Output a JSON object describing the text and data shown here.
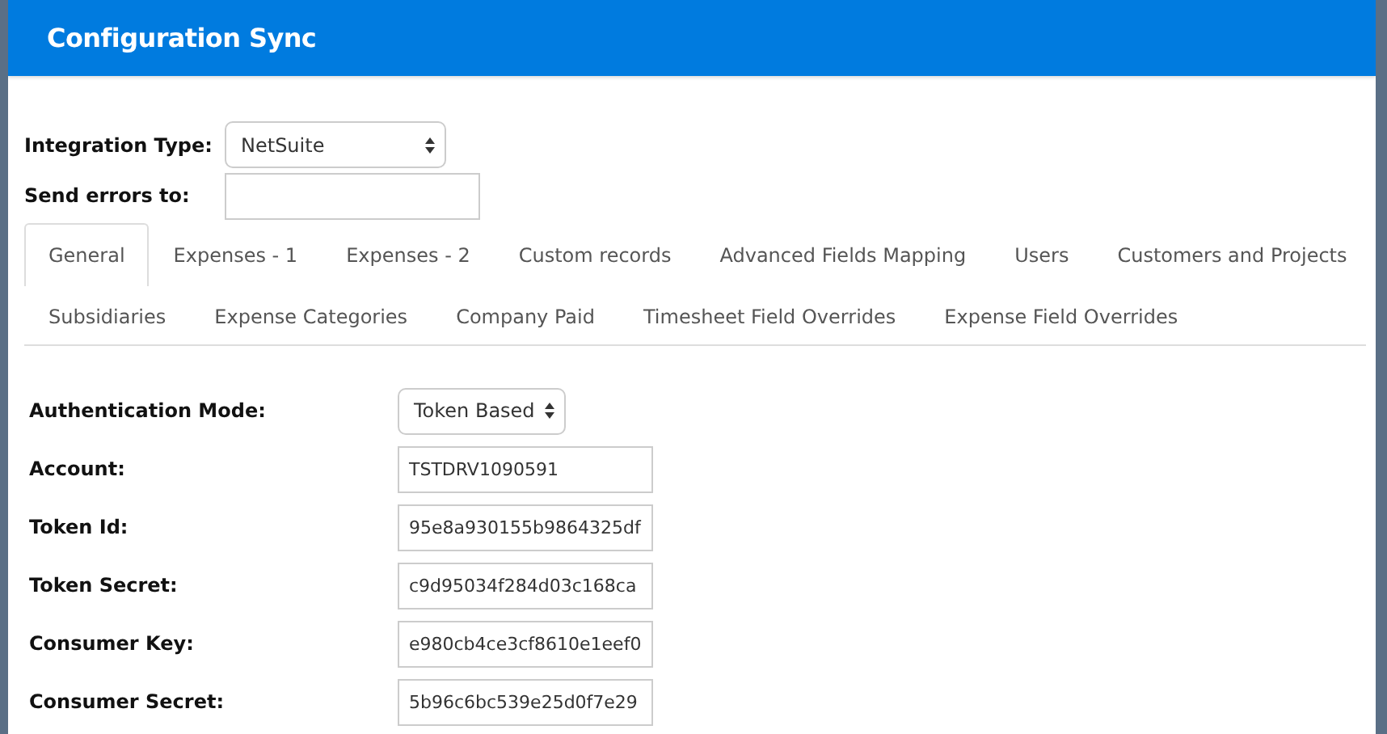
{
  "window": {
    "title": "Configuration Sync"
  },
  "header_fields": [
    {
      "label": "Integration Type:",
      "kind": "select",
      "value": "NetSuite"
    },
    {
      "label": "Send errors to:",
      "kind": "text"
    }
  ],
  "tab_rows": [
    [
      {
        "label": "General",
        "selected": true
      },
      {
        "label": "Expenses - 1",
        "selected": false
      },
      {
        "label": "Expenses - 2",
        "selected": false
      },
      {
        "label": "Custom records",
        "selected": false
      },
      {
        "label": "Advanced Fields Mapping",
        "selected": false
      },
      {
        "label": "Users",
        "selected": false
      },
      {
        "label": "Customers and Projects",
        "selected": false
      }
    ],
    [
      {
        "label": "Subsidiaries",
        "selected": false
      },
      {
        "label": "Expense Categories",
        "selected": false
      },
      {
        "label": "Company Paid",
        "selected": false
      },
      {
        "label": "Timesheet Field Overrides",
        "selected": false
      },
      {
        "label": "Expense Field Overrides",
        "selected": false
      }
    ]
  ],
  "settings": [
    {
      "label": "Authentication Mode:",
      "kind": "select",
      "value": "Token Based"
    },
    {
      "label": "Account:",
      "kind": "text",
      "value": "TSTDRV1090591"
    },
    {
      "label": "Token Id:",
      "kind": "text",
      "value": "95e8a930155b9864325df"
    },
    {
      "label": "Token Secret:",
      "kind": "text",
      "value": "c9d95034f284d03c168ca"
    },
    {
      "label": "Consumer Key:",
      "kind": "text",
      "value": "e980cb4ce3cf8610e1eef0"
    },
    {
      "label": "Consumer Secret:",
      "kind": "text",
      "value": "5b96c6bc539e25d0f7e29"
    }
  ]
}
